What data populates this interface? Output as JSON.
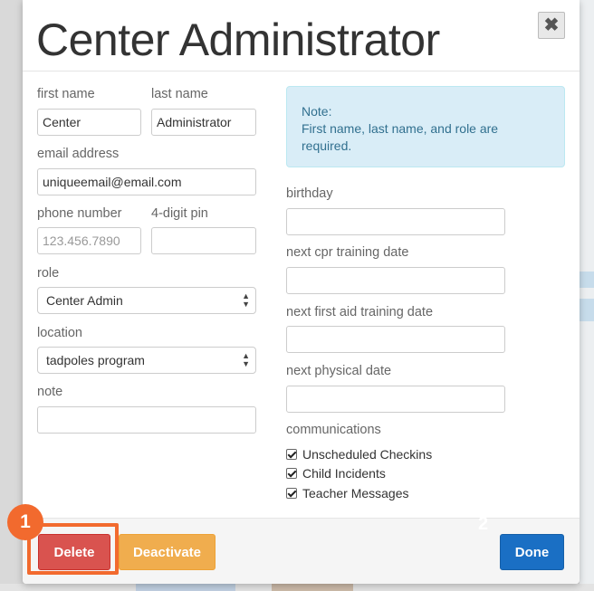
{
  "modal": {
    "title": "Center Administrator",
    "close_symbol": "✖"
  },
  "form": {
    "first_name": {
      "label": "first name",
      "value": "Center"
    },
    "last_name": {
      "label": "last name",
      "value": "Administrator"
    },
    "email": {
      "label": "email address",
      "value": "uniqueemail@email.com"
    },
    "phone": {
      "label": "phone number",
      "placeholder": "123.456.7890"
    },
    "pin": {
      "label": "4-digit pin",
      "value": ""
    },
    "role": {
      "label": "role",
      "selected": "Center Admin"
    },
    "location": {
      "label": "location",
      "selected": "tadpoles program"
    },
    "note": {
      "label": "note",
      "value": ""
    },
    "birthday": {
      "label": "birthday",
      "value": ""
    },
    "cpr_date": {
      "label": "next cpr training date",
      "value": ""
    },
    "first_aid_date": {
      "label": "next first aid training date",
      "value": ""
    },
    "physical_date": {
      "label": "next physical date",
      "value": ""
    }
  },
  "note_box": {
    "heading": "Note:",
    "text": "First name, last name, and role are required."
  },
  "communications": {
    "label": "communications",
    "options": [
      {
        "label": "Unscheduled Checkins",
        "checked": true
      },
      {
        "label": "Child Incidents",
        "checked": true
      },
      {
        "label": "Teacher Messages",
        "checked": true
      }
    ]
  },
  "footer": {
    "delete_label": "Delete",
    "deactivate_label": "Deactivate",
    "done_label": "Done"
  },
  "annotations": {
    "step_1": "1",
    "step_2": "2"
  },
  "colors": {
    "danger": "#d9534f",
    "warning": "#f0ad4e",
    "primary": "#1a6fc4",
    "info_bg": "#d9edf7",
    "highlight": "#f26a2e"
  }
}
